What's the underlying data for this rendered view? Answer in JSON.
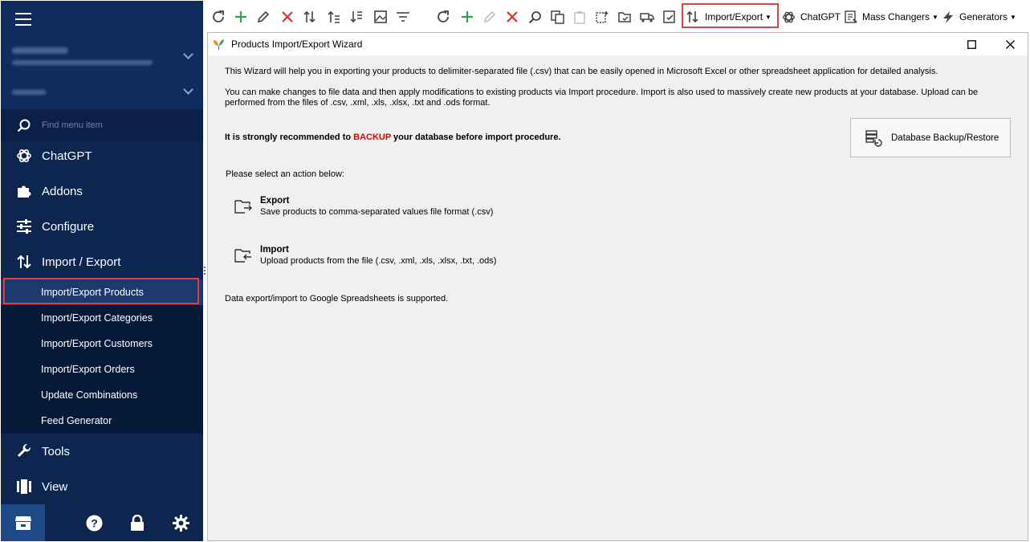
{
  "sidebar": {
    "search_placeholder": "Find menu item",
    "items": [
      {
        "label": "ChatGPT",
        "icon": "chatgpt-icon"
      },
      {
        "label": "Addons",
        "icon": "puzzle-icon"
      },
      {
        "label": "Configure",
        "icon": "sliders-icon"
      },
      {
        "label": "Import / Export",
        "icon": "import-export-icon"
      }
    ],
    "subitems": [
      {
        "label": "Import/Export Products"
      },
      {
        "label": "Import/Export Categories"
      },
      {
        "label": "Import/Export Customers"
      },
      {
        "label": "Import/Export Orders"
      },
      {
        "label": "Update Combinations"
      },
      {
        "label": "Feed Generator"
      }
    ],
    "items_after": [
      {
        "label": "Tools",
        "icon": "wrench-icon"
      },
      {
        "label": "View",
        "icon": "columns-icon"
      }
    ]
  },
  "toolbar": {
    "import_export_label": "Import/Export",
    "chatgpt_label": "ChatGPT",
    "mass_changers_label": "Mass Changers",
    "generators_label": "Generators"
  },
  "wizard": {
    "title": "Products Import/Export Wizard",
    "intro1": "This Wizard will help you in exporting your products to delimiter-separated file (.csv) that can be easily opened in Microsoft Excel or other spreadsheet application for detailed analysis.",
    "intro2a": "You can make changes to file data and then apply modifications to existing products via Import procedure. Import is also used to massively create new products at your database. Upload can be",
    "intro2b": "performed from the files of .csv, .xml, .xls, .xlsx, .txt and .ods format.",
    "warn_pre": "It is strongly recommended to ",
    "warn_red": "BACKUP",
    "warn_post": " your database before import procedure.",
    "backup_button": "Database Backup/Restore",
    "select_label": "Please select an action below:",
    "export_title": "Export",
    "export_desc": "Save products to comma-separated values file format (.csv)",
    "import_title": "Import",
    "import_desc": "Upload products from the file (.csv, .xml, .xls, .xlsx, .txt, .ods)",
    "google_note": "Data export/import to Google Spreadsheets is supported."
  },
  "colors": {
    "sidebar_bg": "#0c2650",
    "highlight": "#e2403f",
    "backup_red": "#e00000",
    "add_green": "#2da44e",
    "delete_red": "#d9312b"
  }
}
